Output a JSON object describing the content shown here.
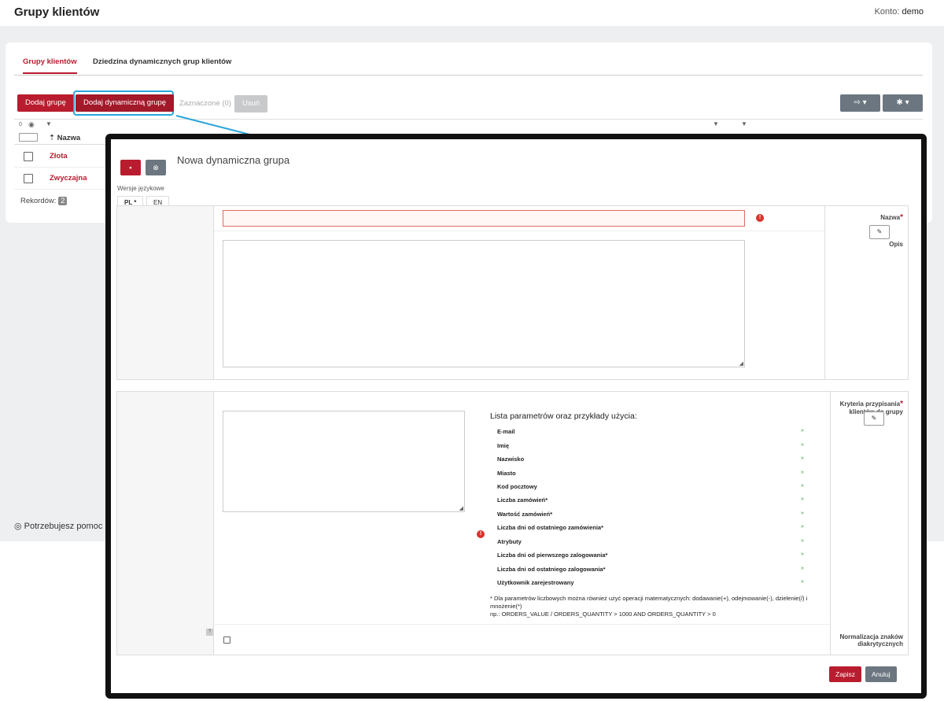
{
  "header": {
    "title": "Grupy klientów",
    "account_label": "Konto:",
    "account_name": "demo"
  },
  "tabs": [
    {
      "label": "Grupy klientów"
    },
    {
      "label": "Dziedzina dynamicznych grup klientów"
    }
  ],
  "toolbar": {
    "add_group": "Dodaj grupę",
    "add_dynamic_group": "Dodaj dynamiczną grupę",
    "selected": "Zaznaczone (0)",
    "delete": "Usuń"
  },
  "grid": {
    "counter": "0",
    "column_name": "Nazwa",
    "rows": [
      {
        "name": "Złota"
      },
      {
        "name": "Zwyczajna"
      }
    ],
    "records_label": "Rekordów:",
    "records_count": "2"
  },
  "help_text": "Potrzebujesz pomoc",
  "modal": {
    "title": "Nowa dynamiczna grupa",
    "lang_versions_label": "Wersje językowe",
    "lang_tabs": [
      {
        "label": "PL *"
      },
      {
        "label": "EN"
      }
    ],
    "field_name_label": "Nazwa",
    "field_name_value": "",
    "field_description_label": "Opis",
    "field_description_value": "",
    "criteria_label_line1": "Kryteria przypisania",
    "criteria_label_line2": "klientów do grupy",
    "criteria_value": "",
    "params_title": "Lista parametrów oraz przykłady użycia:",
    "params": [
      {
        "label": "E-mail"
      },
      {
        "label": "Imię"
      },
      {
        "label": "Nazwisko"
      },
      {
        "label": "Miasto"
      },
      {
        "label": "Kod pocztowy"
      },
      {
        "label": "Liczba zamówień*"
      },
      {
        "label": "Wartość zamówień*"
      },
      {
        "label": "Liczba dni od ostatniego zamówienia*"
      },
      {
        "label": "Atrybuty"
      },
      {
        "label": "Liczba dni od pierwszego zalogowania*"
      },
      {
        "label": "Liczba dni od ostatniego zalogowania*"
      },
      {
        "label": "Użytkownik zarejestrowany"
      }
    ],
    "note_line1": "* Dla parametrów liczbowych można również użyć operacji matematycznych: dodawanie(+), odejmowanie(-), dzielenie(/) i mnożenie(*)",
    "note_line2": "np.: ORDERS_VALUE / ORDERS_QUANTITY > 1000 AND ORDERS_QUANTITY > 0",
    "normalization_label_line1": "Normalizacja znaków",
    "normalization_label_line2": "diakrytycznych",
    "help_mark": "?",
    "save": "Zapisz",
    "cancel": "Anuluj"
  },
  "colors": {
    "brand": "#b91c2e",
    "highlight": "#2aa6db",
    "error": "#d9332b"
  }
}
